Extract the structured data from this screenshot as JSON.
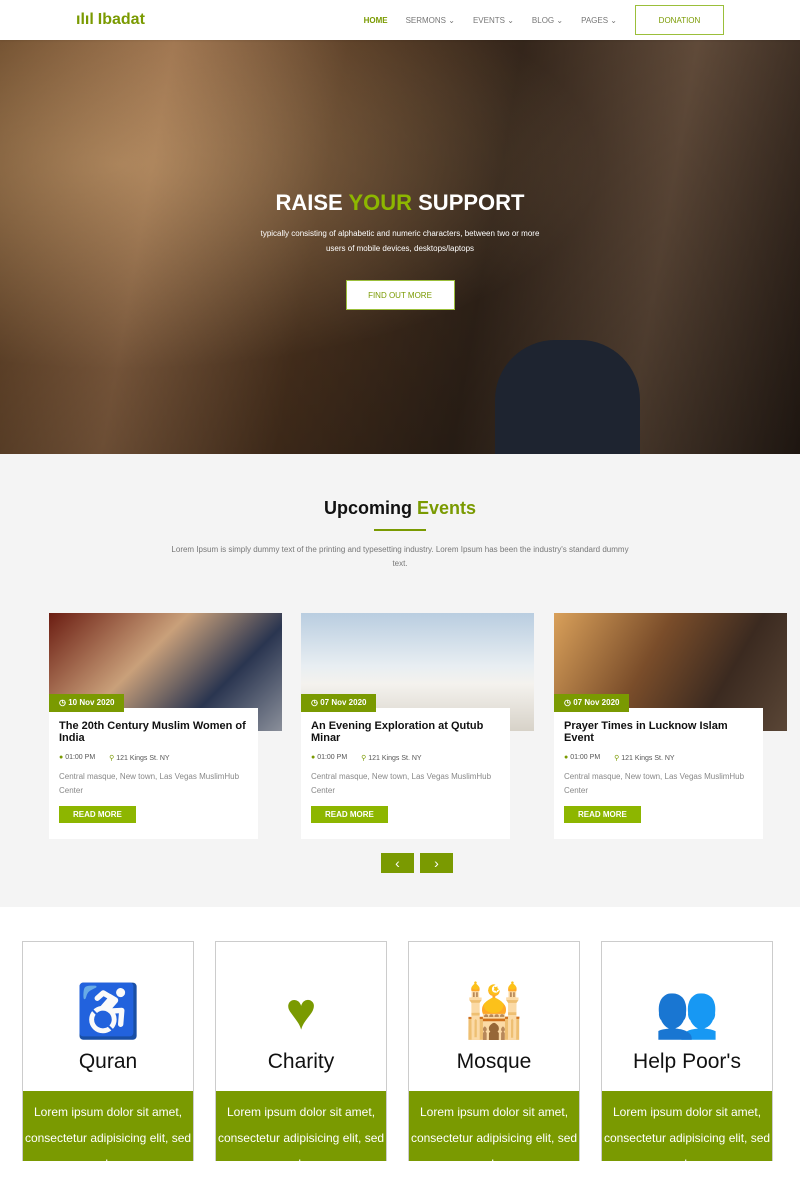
{
  "nav": {
    "logo": "Ibadat",
    "items": [
      "HOME",
      "SERMONS",
      "EVENTS",
      "BLOG",
      "PAGES"
    ],
    "donation": "DONATION"
  },
  "hero": {
    "title_a": "RAISE ",
    "title_b": "YOUR",
    "title_c": " SUPPORT",
    "text1": "typically consisting of alphabetic and numeric characters, between two or more",
    "text2": "users of mobile devices, desktops/laptops",
    "button": "FIND OUT MORE"
  },
  "events": {
    "title_a": "Upcoming ",
    "title_b": "Events",
    "sub": "Lorem Ipsum is simply dummy text of the printing and typesetting industry. Lorem Ipsum has been the industry's standard dummy text.",
    "cards": [
      {
        "date": "10 Nov 2020",
        "title": "The 20th Century Muslim Women of India",
        "time": "01:00 PM",
        "place": "121 Kings St. NY",
        "desc": "Central masque, New town, Las Vegas MuslimHub Center",
        "button": "READ MORE"
      },
      {
        "date": "07 Nov 2020",
        "title": "An Evening Exploration at Qutub Minar",
        "time": "01:00 PM",
        "place": "121 Kings St. NY",
        "desc": "Central masque, New town, Las Vegas MuslimHub Center",
        "button": "READ MORE"
      },
      {
        "date": "07 Nov 2020",
        "title": "Prayer Times in Lucknow Islam Event",
        "time": "01:00 PM",
        "place": "121 Kings St. NY",
        "desc": "Central masque, New town, Las Vegas MuslimHub Center",
        "button": "READ MORE"
      }
    ],
    "prev": "‹",
    "next": "›"
  },
  "features": [
    {
      "icon": "wheelchair-icon",
      "glyph": "♿",
      "title": "Quran",
      "text": "Lorem ipsum dolor sit amet, consectetur adipisicing elit, sed do"
    },
    {
      "icon": "heart-icon",
      "glyph": "♥",
      "title": "Charity",
      "text": "Lorem ipsum dolor sit amet, consectetur adipisicing elit, sed do"
    },
    {
      "icon": "mosque-icon",
      "glyph": "🕌",
      "title": "Mosque",
      "text": "Lorem ipsum dolor sit amet, consectetur adipisicing elit, sed do"
    },
    {
      "icon": "users-icon",
      "glyph": "👥",
      "title": "Help Poor's",
      "text": "Lorem ipsum dolor sit amet, consectetur adipisicing elit, sed do"
    }
  ],
  "colors": {
    "accent": "#7a9a01",
    "button": "#8db600"
  }
}
